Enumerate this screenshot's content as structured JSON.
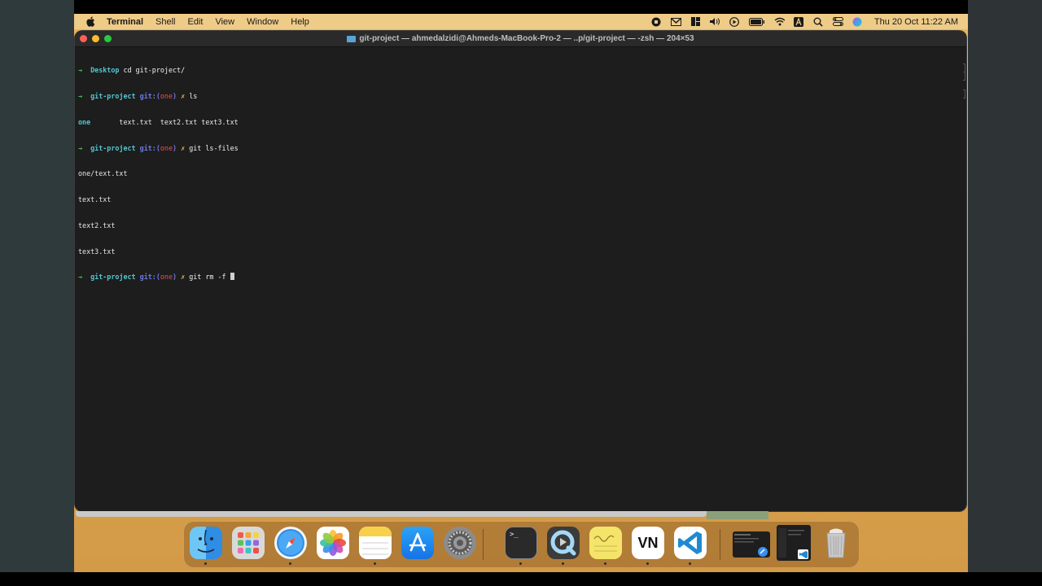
{
  "menubar": {
    "app_name": "Terminal",
    "menus": [
      "Shell",
      "Edit",
      "View",
      "Window",
      "Help"
    ],
    "clock": "Thu 20 Oct  11:22 AM",
    "status_icons": [
      "record-stop-icon",
      "gmail-icon",
      "grid-icon",
      "volume-icon",
      "play-icon",
      "battery-icon",
      "wifi-icon",
      "input-source-icon",
      "spotlight-search-icon",
      "control-center-icon",
      "siri-icon"
    ]
  },
  "window": {
    "title": "git-project — ahmedalzidi@Ahmeds-MacBook-Pro-2 — ..p/git-project — -zsh — 204×53"
  },
  "terminal": {
    "lines": [
      {
        "arrow": "→",
        "dir": "Desktop",
        "cmd": " cd git-project/"
      },
      {
        "arrow": "→",
        "dir": "git-project",
        "git": "git:(",
        "branch": "one",
        "git_close": ")",
        "dirty": "✗",
        "cmd": " ls"
      },
      {
        "ls_dir": "one",
        "text": "       text.txt  text2.txt text3.txt"
      },
      {
        "arrow": "→",
        "dir": "git-project",
        "git": "git:(",
        "branch": "one",
        "git_close": ")",
        "dirty": "✗",
        "cmd": " git ls-files"
      },
      {
        "text": "one/text.txt"
      },
      {
        "text": "text.txt"
      },
      {
        "text": "text2.txt"
      },
      {
        "text": "text3.txt"
      },
      {
        "arrow": "→",
        "dir": "git-project",
        "git": "git:(",
        "branch": "one",
        "git_close": ")",
        "dirty": "✗",
        "cmd": " git rm -f "
      }
    ]
  },
  "dock": {
    "apps": [
      "Finder",
      "Launchpad",
      "Safari",
      "Photos",
      "Notes",
      "App Store",
      "System Settings",
      "Terminal",
      "QuickTime Player",
      "Stickies",
      "VN",
      "Visual Studio Code"
    ],
    "vn_label": "VN",
    "terminal_glyph": ">_"
  },
  "colors": {
    "terminal_bg": "#1d1d1d",
    "prompt_arrow": "#3fcf5a",
    "prompt_dir": "#55c5cf",
    "git_label": "#6a78e6",
    "branch": "#e4544a",
    "dirty_mark": "#e8c04a",
    "wallpaper": "#e9b45e"
  }
}
